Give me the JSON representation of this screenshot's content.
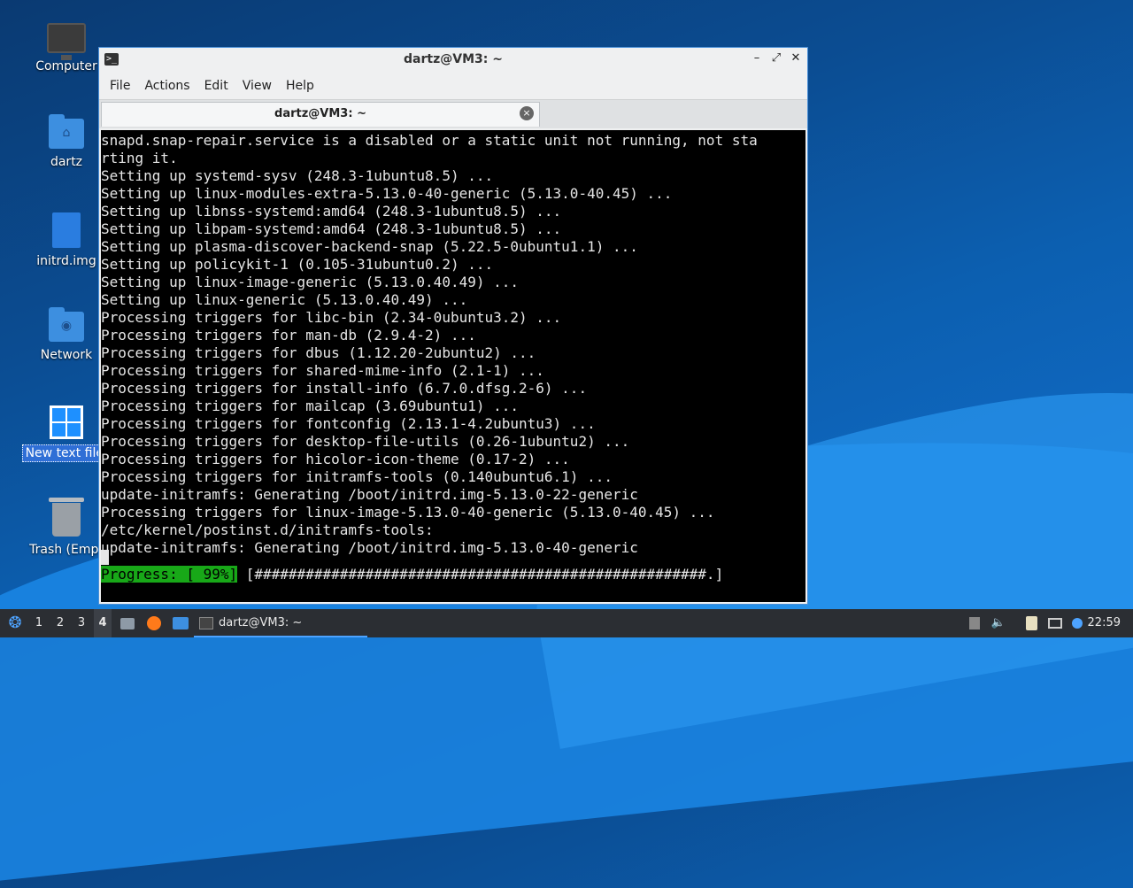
{
  "desktop": {
    "icons": [
      {
        "label": "Computer"
      },
      {
        "label": "dartz"
      },
      {
        "label": "initrd.img"
      },
      {
        "label": "Network"
      },
      {
        "label": "New text file."
      },
      {
        "label": "Trash (Empt"
      }
    ]
  },
  "window": {
    "title": "dartz@VM3: ~",
    "controls": {
      "minimize": "–",
      "maximize": "⤢",
      "close": "✕"
    },
    "menu": [
      "File",
      "Actions",
      "Edit",
      "View",
      "Help"
    ],
    "tab": {
      "label": "dartz@VM3: ~",
      "close": "×"
    }
  },
  "terminal": {
    "output": "snapd.snap-repair.service is a disabled or a static unit not running, not sta\nrting it.\nSetting up systemd-sysv (248.3-1ubuntu8.5) ...\nSetting up linux-modules-extra-5.13.0-40-generic (5.13.0-40.45) ...\nSetting up libnss-systemd:amd64 (248.3-1ubuntu8.5) ...\nSetting up libpam-systemd:amd64 (248.3-1ubuntu8.5) ...\nSetting up plasma-discover-backend-snap (5.22.5-0ubuntu1.1) ...\nSetting up policykit-1 (0.105-31ubuntu0.2) ...\nSetting up linux-image-generic (5.13.0.40.49) ...\nSetting up linux-generic (5.13.0.40.49) ...\nProcessing triggers for libc-bin (2.34-0ubuntu3.2) ...\nProcessing triggers for man-db (2.9.4-2) ...\nProcessing triggers for dbus (1.12.20-2ubuntu2) ...\nProcessing triggers for shared-mime-info (2.1-1) ...\nProcessing triggers for install-info (6.7.0.dfsg.2-6) ...\nProcessing triggers for mailcap (3.69ubuntu1) ...\nProcessing triggers for fontconfig (2.13.1-4.2ubuntu3) ...\nProcessing triggers for desktop-file-utils (0.26-1ubuntu2) ...\nProcessing triggers for hicolor-icon-theme (0.17-2) ...\nProcessing triggers for initramfs-tools (0.140ubuntu6.1) ...\nupdate-initramfs: Generating /boot/initrd.img-5.13.0-22-generic\nProcessing triggers for linux-image-5.13.0-40-generic (5.13.0-40.45) ...\n/etc/kernel/postinst.d/initramfs-tools:\nupdate-initramfs: Generating /boot/initrd.img-5.13.0-40-generic",
    "progress_label": "Progress: [ 99%]",
    "progress_bar": " [#####################################################.]",
    "progress_percent": 99
  },
  "taskbar": {
    "workspaces": [
      "1",
      "2",
      "3",
      "4"
    ],
    "active_workspace": "4",
    "app_label": "dartz@VM3: ~",
    "clock": "22:59"
  },
  "colors": {
    "accent": "#4a90d9",
    "progress_green": "#18a818",
    "taskbar_bg": "#2b2e33",
    "terminal_bg": "#000000"
  }
}
